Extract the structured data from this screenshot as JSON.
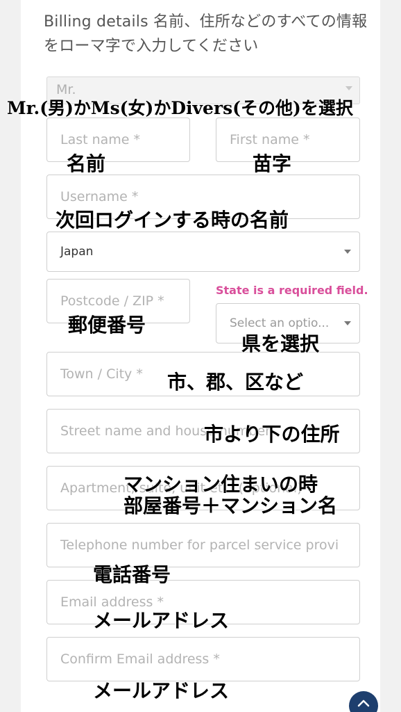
{
  "heading": "Billing details 名前、住所などのすべての情報をローマ字で入力してください",
  "form": {
    "title_select_value": "Mr.",
    "last_name_placeholder": "Last name *",
    "first_name_placeholder": "First name *",
    "username_placeholder": "Username *",
    "country_value": "Japan",
    "postcode_placeholder": "Postcode / ZIP *",
    "state_error": "State is a required field.",
    "state_placeholder": "Select an optio...",
    "town_placeholder": "Town / City *",
    "street_placeholder": "Street name and house number",
    "apartment_placeholder": "Apartment, suite, unit etc. (optional)",
    "telephone_placeholder": "Telephone number for parcel service provi",
    "email_placeholder": "Email address *",
    "confirm_email_placeholder": "Confirm Email address *"
  },
  "annotations": {
    "title_note": "Mr.(男)かMs(女)かDivers(その他)を選択",
    "last_name_note": "名前",
    "first_name_note": "苗字",
    "username_note": "次回ログインする時の名前",
    "postcode_note": "郵便番号",
    "state_note": "県を選択",
    "town_note": "市、郡、区など",
    "street_note": "市より下の住所",
    "apartment_note_1": "マンション住まいの時",
    "apartment_note_2": "部屋番号＋マンション名",
    "telephone_note": "電話番号",
    "email_note": "メールアドレス",
    "confirm_email_note": "メールアドレス"
  },
  "icons": {
    "caret": "chevron-down-icon",
    "scroll_top": "chevron-up-icon"
  },
  "colors": {
    "error": "#d94f9b",
    "scroll_button": "#1e3f6e"
  }
}
